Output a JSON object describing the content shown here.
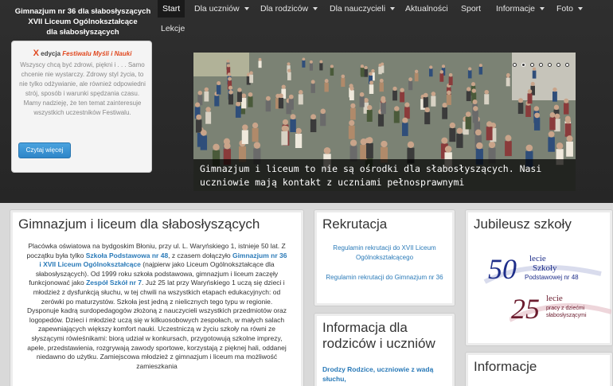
{
  "brand": {
    "line1": "Gimnazjum nr 36 dla słabosłyszących",
    "line2": "XVII Liceum Ogólnokształcące",
    "line3": "dla słabosłyszących"
  },
  "nav": {
    "items": [
      {
        "label": "Start",
        "dropdown": false,
        "active": true
      },
      {
        "label": "Dla uczniów",
        "dropdown": true
      },
      {
        "label": "Dla rodziców",
        "dropdown": true
      },
      {
        "label": "Dla nauczycieli",
        "dropdown": true
      },
      {
        "label": "Aktualności",
        "dropdown": false
      },
      {
        "label": "Sport",
        "dropdown": false
      },
      {
        "label": "Informacje",
        "dropdown": true
      },
      {
        "label": "Foto",
        "dropdown": true
      }
    ],
    "second_row": "Lekcje"
  },
  "promo": {
    "x": "X",
    "edition": "edycja",
    "festival": "Festiwalu Myśli i Nauki",
    "text": "Wszyscy chcą być zdrowi, piękni i . . . Samo chcenie nie wystarczy. Zdrowy styl życia, to nie tylko odżywianie, ale również odpowiedni strój, sposób i warunki spędzania czasu. Mamy nadzieję, że ten temat zainteresuje wszystkich uczestników Festiwalu.",
    "button": "Czytaj więcej"
  },
  "slider": {
    "caption": "Gimnazjum i liceum to nie są ośrodki dla słabosłyszących. Nasi uczniowie mają kontakt z uczniami pełnosprawnymi",
    "slide_count": 7,
    "active_index": 1
  },
  "main": {
    "title": "Gimnazjum i liceum dla słabosłyszących",
    "p1_a": "Placówka oświatowa na bydgoskim Błoniu, przy ul. L. Waryńskiego 1, istnieje 50 lat. Z początku była tylko ",
    "p1_link1": "Szkoła Podstawowa nr 48",
    "p1_b": ", z czasem dołączyło ",
    "p1_link2": "Gimnazjum nr 36 i XVII Liceum Ogólnokształcące",
    "p1_c": " (najpierw jako Liceum Ogólnokształcące dla słabosłyszących).  Od 1999 roku szkoła podstawowa, gimnazjum i liceum zaczęły funkcjonować jako ",
    "p1_link3": "Zespół Szkół nr 7",
    "p1_d": ". Już 25 lat przy Waryńskiego 1 uczą się dzieci i młodzież z dysfunkcją słuchu, w tej chwili na wszystkich etapach edukacyjnych: od zerówki po maturzystów. Szkoła jest jedną z nielicznych tego typu w regionie. Dysponuje kadrą surdopedagogów złożoną z nauczycieli wszystkich przedmiotów oraz logopedów. Dzieci i młodzież uczą się w kilkuosobowych zespołach, w małych salach zapewniających większy komfort nauki. Uczestniczą w życiu szkoły na równi ze słyszącymi rówieśnikami: biorą udział w konkursach, przygotowują szkolne imprezy, apele, przedstawienia, rozgrywają zawody sportowe, korzystają z pięknej hali, oddanej niedawno do użytku. Zamiejscowa młodzież z gimnazjum i liceum ma możliwość zamieszkania"
  },
  "rekrutacja": {
    "title": "Rekrutacja",
    "links": [
      "Regulamin rekrutacji do XVII Liceum Ogólnokształcącego",
      "Regulamin rekrutacji do Gimnazjum nr 36"
    ]
  },
  "info_parents": {
    "title": "Informacja dla rodziców i uczniów",
    "lead": "Drodzy Rodzice, uczniowie z wadą słuchu,"
  },
  "jubileusz": {
    "title": "Jubileusz szkoły",
    "logo50": {
      "num": "50",
      "l1": "lecie",
      "l2": "Szkoły",
      "l3": "Podstawowej nr 48"
    },
    "logo25": {
      "num": "25",
      "l1": "lecie",
      "l2": "pracy z dziećmi",
      "l3": "słabosłyszącymi"
    }
  },
  "informacje": {
    "title": "Informacje"
  },
  "colors": {
    "link": "#2a7ab8",
    "accent": "#e0471e",
    "topbar": "#2b2b2b"
  }
}
